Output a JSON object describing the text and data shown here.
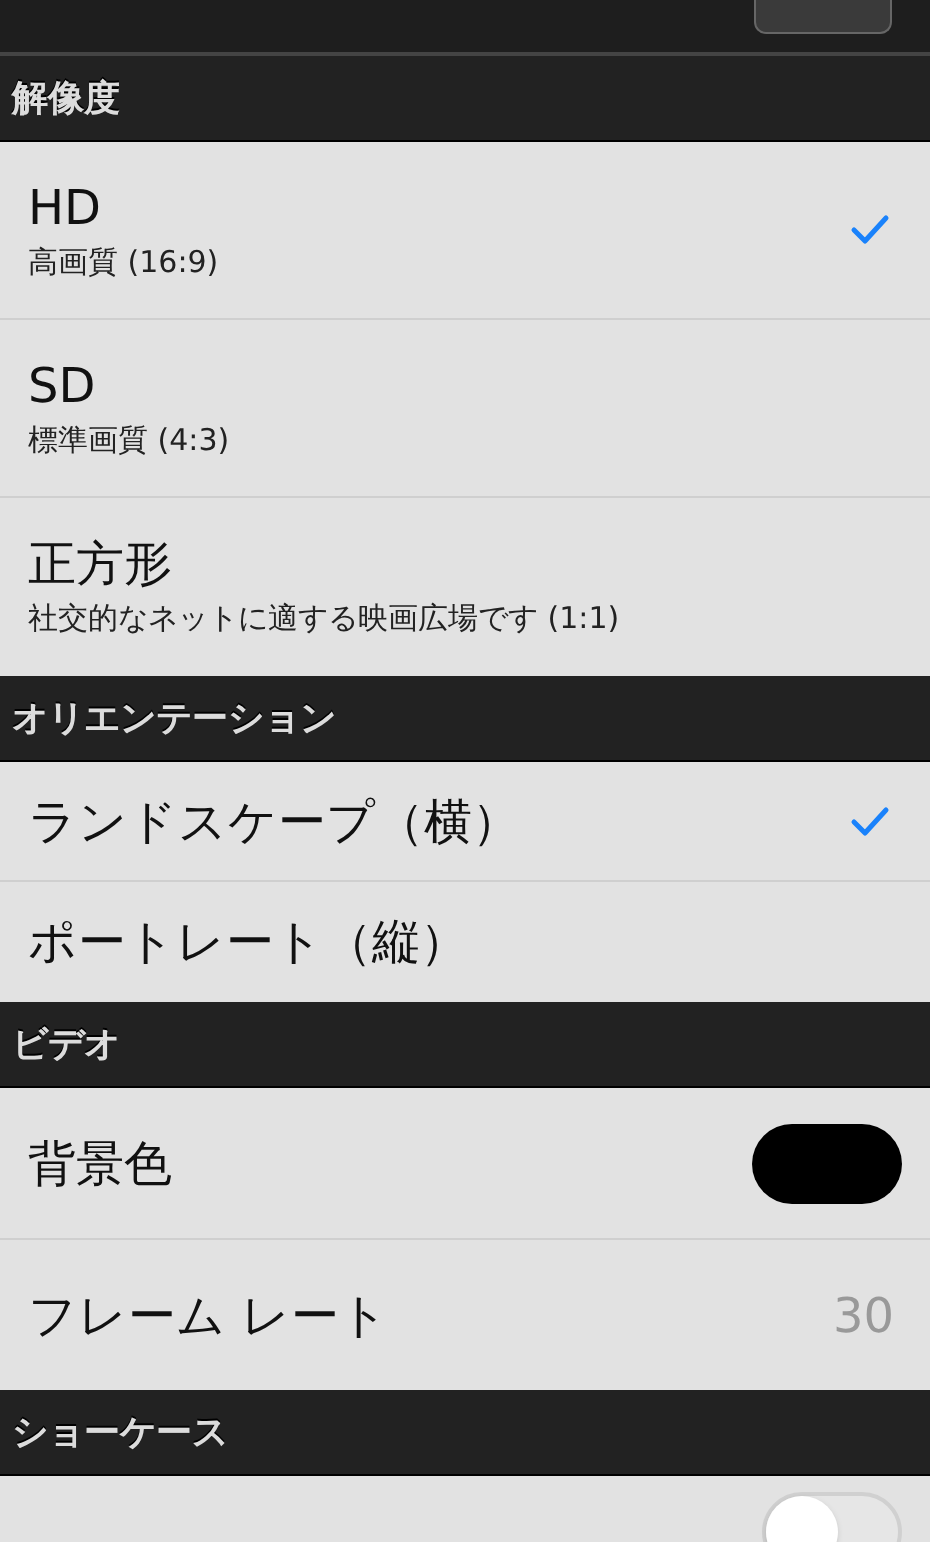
{
  "nav_bar": {
    "has_button": true
  },
  "sections": [
    {
      "header": "解像度",
      "rows": [
        {
          "kind": "option",
          "label": "HD",
          "subtitle": "高画質 (16:9)",
          "selected": true
        },
        {
          "kind": "option",
          "label": "SD",
          "subtitle": "標準画質 (4:3)",
          "selected": false
        },
        {
          "kind": "option",
          "label": "正方形",
          "subtitle": "社交的なネットに適する映画広場です (1:1)",
          "selected": false
        }
      ]
    },
    {
      "header": "オリエンテーション",
      "rows": [
        {
          "kind": "option",
          "label": "ランドスケープ（横）",
          "selected": true
        },
        {
          "kind": "option",
          "label": "ポートレート（縦）",
          "selected": false
        }
      ]
    },
    {
      "header": "ビデオ",
      "rows": [
        {
          "kind": "color",
          "label": "背景色",
          "color": "#000000"
        },
        {
          "kind": "value",
          "label": "フレーム レート",
          "value": "30"
        }
      ]
    },
    {
      "header": "ショーケース",
      "rows": [
        {
          "kind": "toggle",
          "on": false
        }
      ]
    }
  ]
}
